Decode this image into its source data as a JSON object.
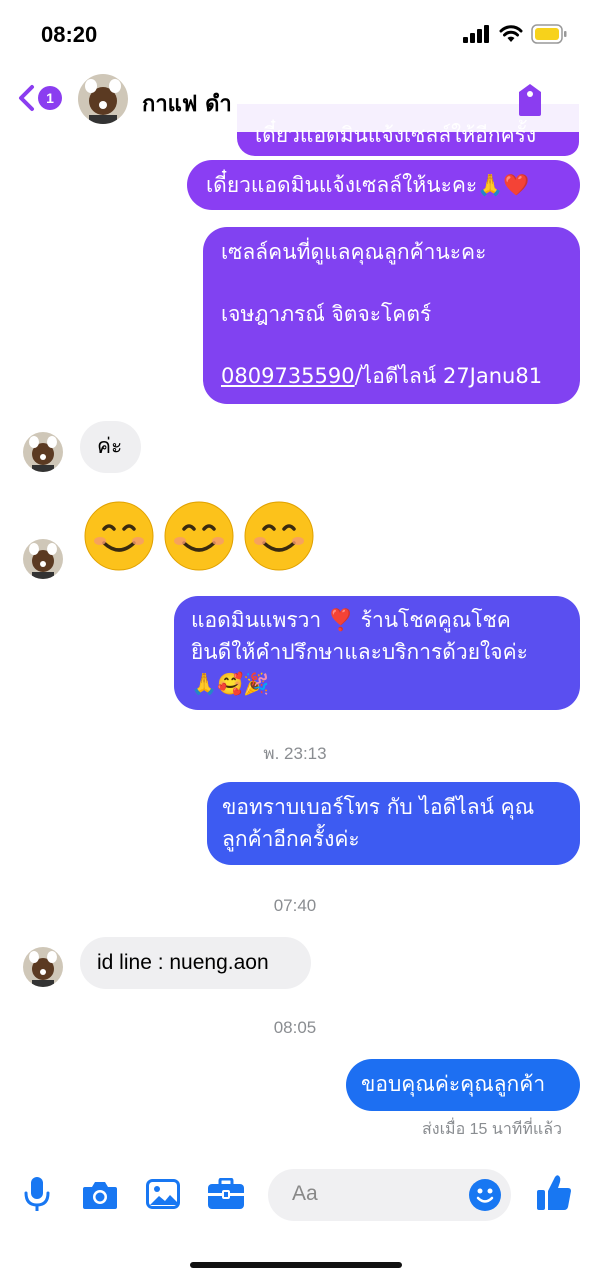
{
  "status_bar": {
    "time": "08:20"
  },
  "header": {
    "back_badge_count": "1",
    "contact_name": "กาแฟ ดำ",
    "accent_color": "#8b3df0"
  },
  "messages": {
    "m0_partial": "เดี๋ยวแอดมินแจ้งเซลล์ให้อีกครั้ง",
    "m1": "เดี๋ยวแอดมินแจ้งเซลล์ให้นะคะ🙏❤️",
    "m2_line1": "เซลล์คนที่ดูแลคุณลูกค้านะคะ",
    "m2_line2": "เจษฎาภรณ์ จิตจะโคตร์",
    "m2_phone": "0809735590",
    "m2_line3_rest": "/ไอดีไลน์ 27Janu81",
    "m3_in": "ค่ะ",
    "m4_emojis": [
      "😊",
      "😊",
      "😊"
    ],
    "m5_line1": "แอดมินแพรวา ❣️ ร้านโชคคูณโชค",
    "m5_line2": "ยินดีให้คำปรึกษาและบริการด้วยใจค่ะ",
    "m5_line3": "🙏🥰🎉",
    "ts1": "พ. 23:13",
    "m6_line1": "ขอทราบเบอร์โทร กับ ไอดีไลน์ คุณ",
    "m6_line2": "ลูกค้าอีกครั้งค่ะ",
    "ts2": "07:40",
    "m7_in": "id line : nueng.aon",
    "ts3": "08:05",
    "m8": "ขอบคุณค่ะคุณลูกค้า",
    "sent_status": "ส่งเมื่อ 15 นาทีที่แล้ว"
  },
  "composer": {
    "placeholder": "Aa",
    "accent_color": "#1877f2"
  }
}
